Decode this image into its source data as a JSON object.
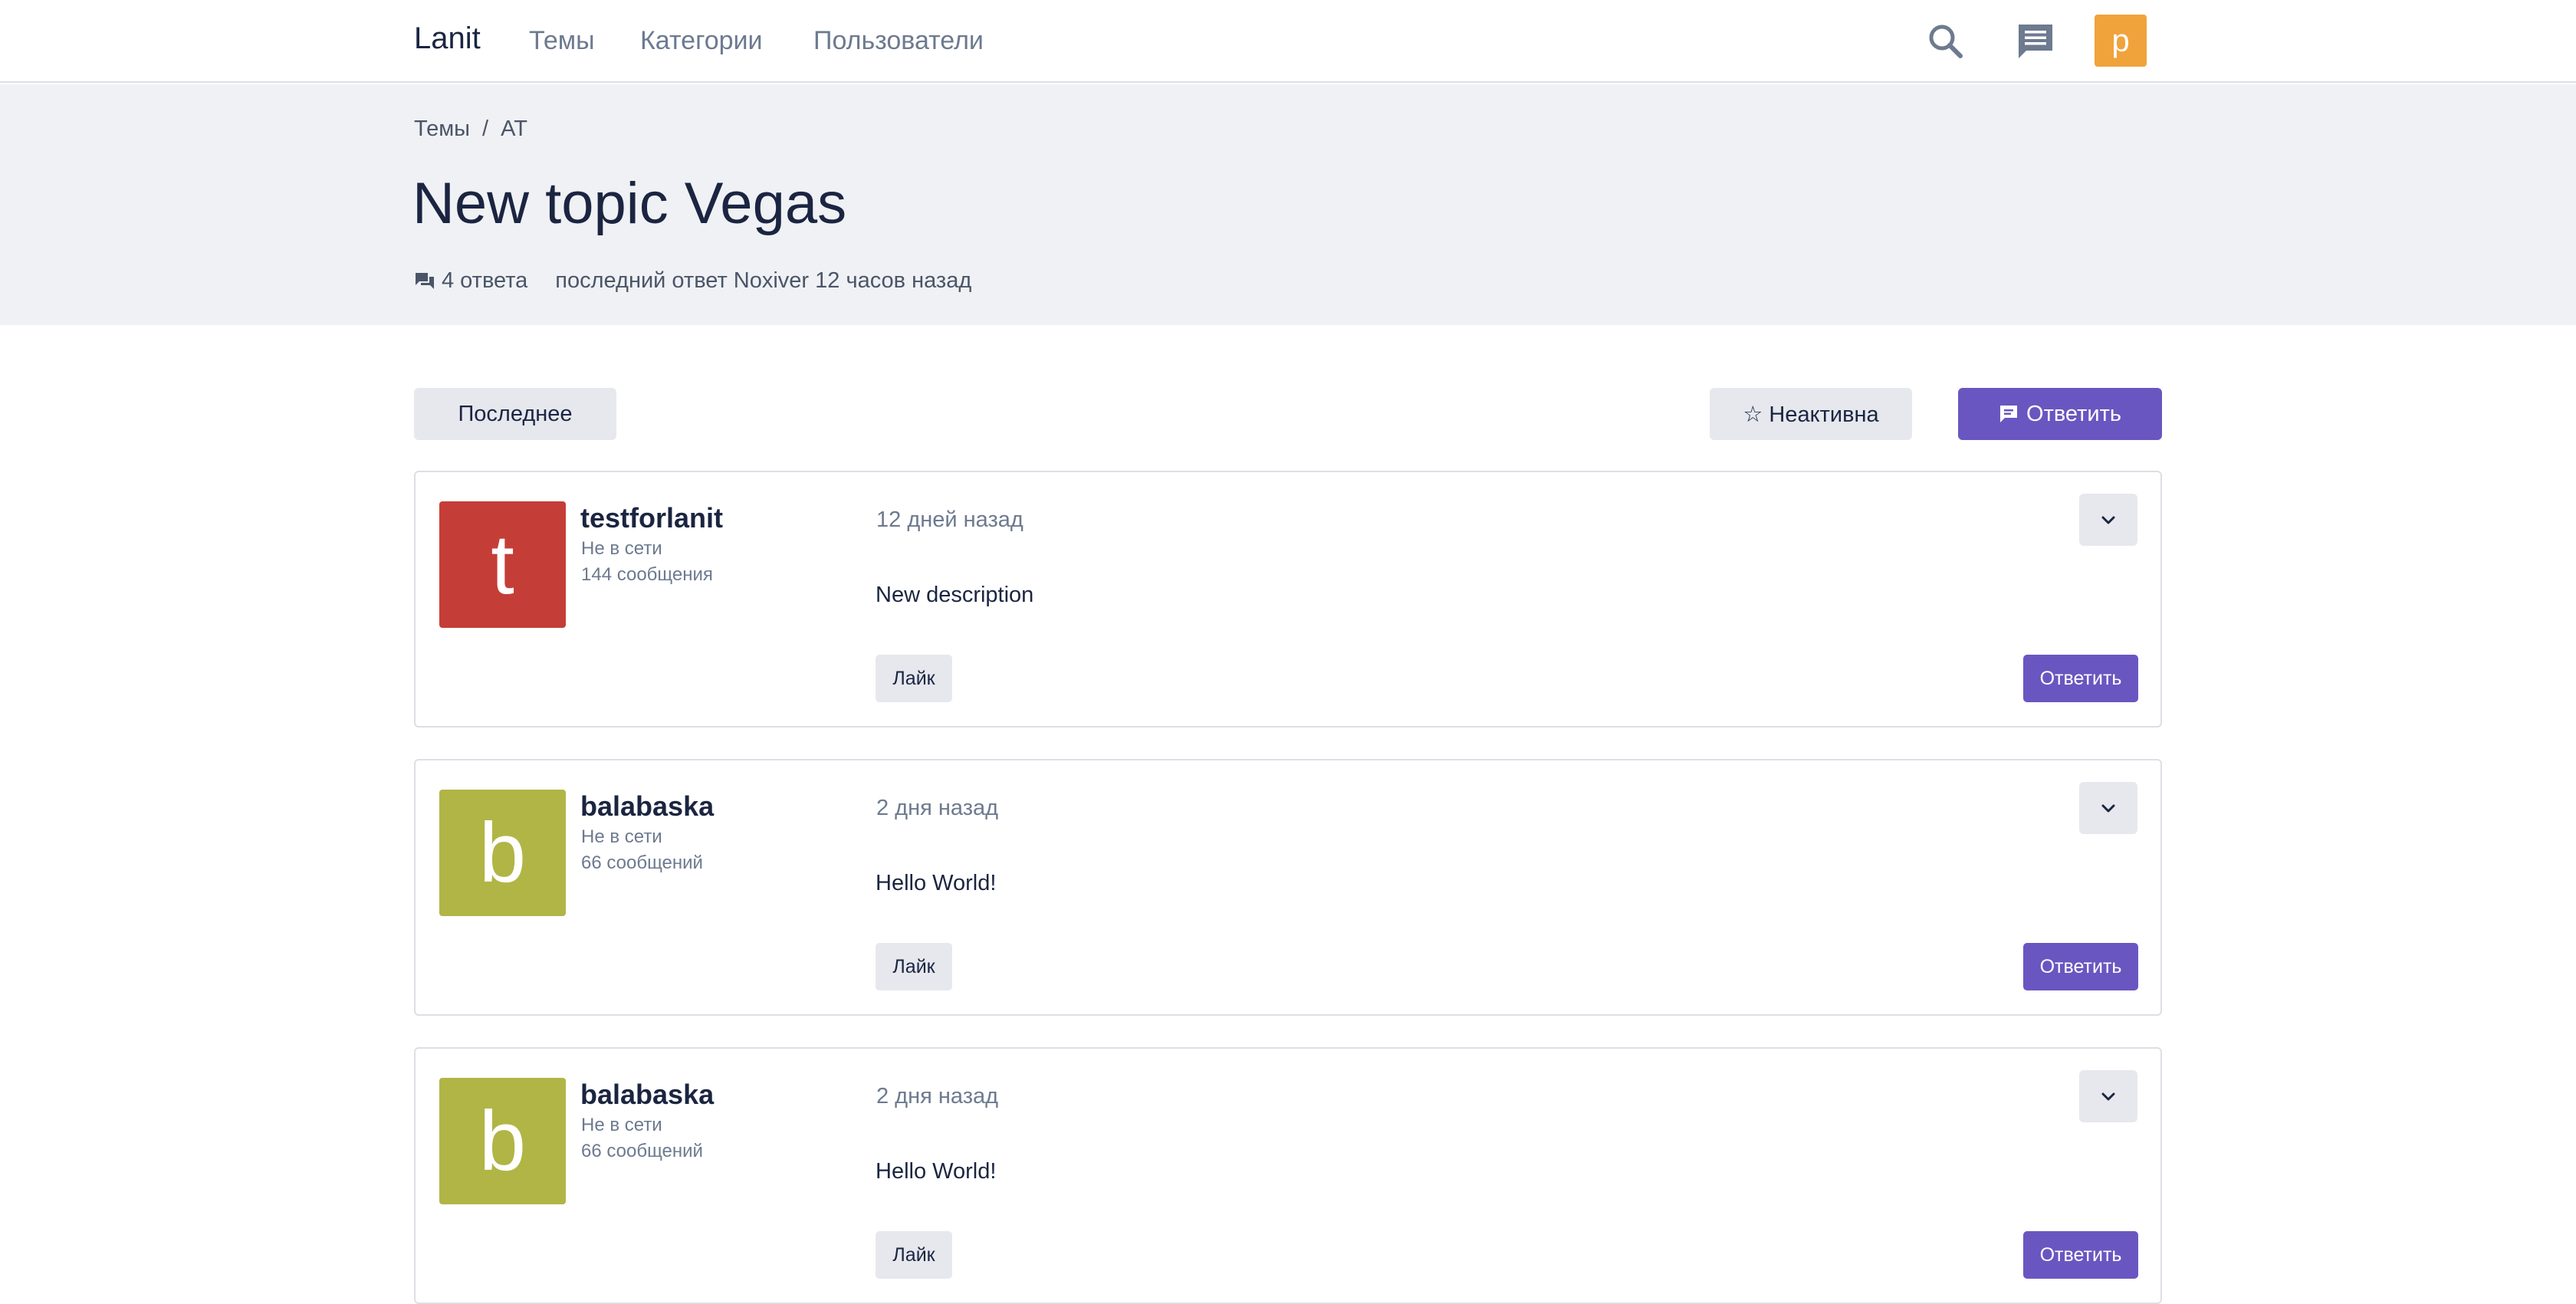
{
  "navbar": {
    "brand": "Lanit",
    "links": [
      "Темы",
      "Категории",
      "Пользователи"
    ],
    "search_icon": "search-icon",
    "messages_icon": "chat-icon",
    "user_avatar_letter": "p",
    "user_avatar_color": "#f0a33a"
  },
  "breadcrumb": {
    "root": "Темы",
    "separator": "/",
    "current": "AT"
  },
  "topic": {
    "title": "New topic Vegas",
    "replies": "4 ответа",
    "last_reply": "последний ответ Noxiver 12 часов назад"
  },
  "actions": {
    "latest": "Последнее",
    "watch": "☆ Неактивна",
    "reply": "Ответить"
  },
  "colors": {
    "primary": "#6a56c0",
    "header_bg": "#eff1f4"
  },
  "posts": [
    {
      "avatar_letter": "t",
      "avatar_color": "#c53d37",
      "username": "testforlanit",
      "status": "Не в сети",
      "post_count": "144 сообщения",
      "date": "12 дней назад",
      "body": "New description",
      "like_label": "Лайк",
      "reply_label": "Ответить"
    },
    {
      "avatar_letter": "b",
      "avatar_color": "#b1b545",
      "username": "balabaska",
      "status": "Не в сети",
      "post_count": "66 сообщений",
      "date": "2 дня назад",
      "body": "Hello World!",
      "like_label": "Лайк",
      "reply_label": "Ответить"
    },
    {
      "avatar_letter": "b",
      "avatar_color": "#b1b545",
      "username": "balabaska",
      "status": "Не в сети",
      "post_count": "66 сообщений",
      "date": "2 дня назад",
      "body": "Hello World!",
      "like_label": "Лайк",
      "reply_label": "Ответить"
    }
  ]
}
